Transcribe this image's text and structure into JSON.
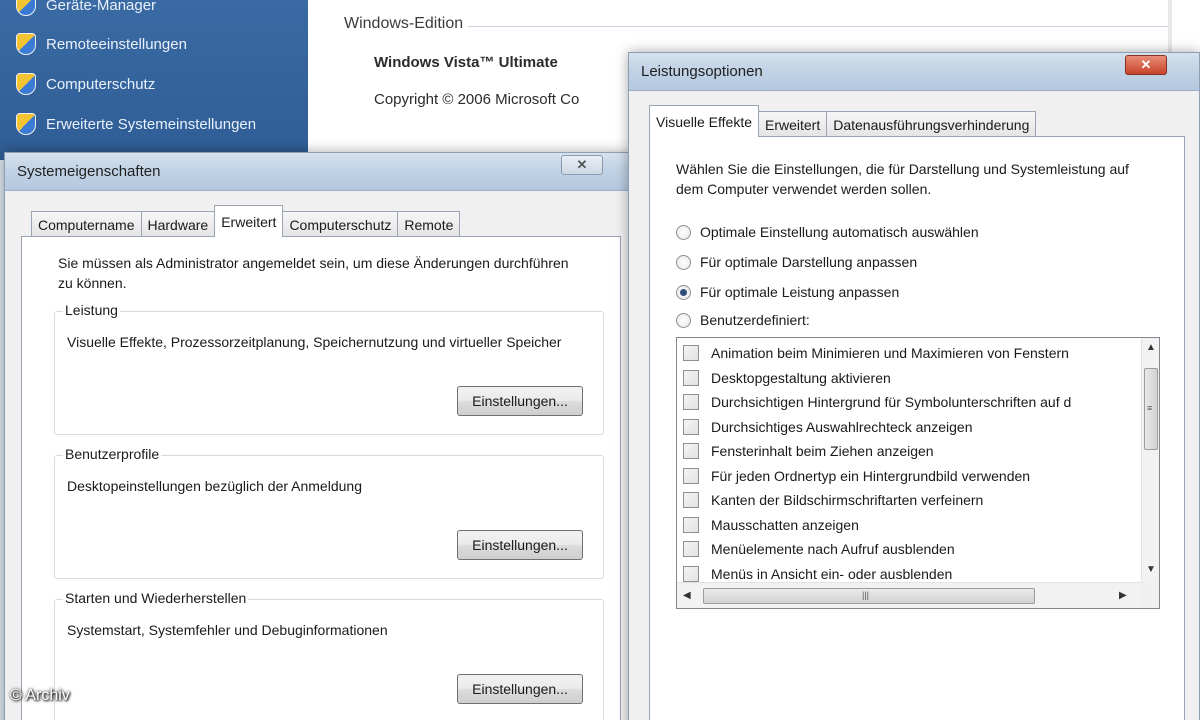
{
  "control_panel": {
    "task_items": [
      "Geräte-Manager",
      "Remoteeinstellungen",
      "Computerschutz",
      "Erweiterte Systemeinstellungen"
    ],
    "section_heading": "Windows-Edition",
    "edition": "Windows Vista™ Ultimate",
    "copyright": "Copyright © 2006 Microsoft Co"
  },
  "system_properties": {
    "title": "Systemeigenschaften",
    "close_label": "✕",
    "tabs": [
      "Computername",
      "Hardware",
      "Erweitert",
      "Computerschutz",
      "Remote"
    ],
    "active_tab": "Erweitert",
    "intro": "Sie müssen als Administrator angemeldet sein, um diese Änderungen durchführen zu können.",
    "groups": [
      {
        "label": "Leistung",
        "description": "Visuelle Effekte, Prozessorzeitplanung, Speichernutzung und virtueller Speicher",
        "button": "Einstellungen..."
      },
      {
        "label": "Benutzerprofile",
        "description": "Desktopeinstellungen bezüglich der Anmeldung",
        "button": "Einstellungen..."
      },
      {
        "label": "Starten und Wiederherstellen",
        "description": "Systemstart, Systemfehler und Debuginformationen",
        "button": "Einstellungen..."
      }
    ]
  },
  "performance_options": {
    "title": "Leistungsoptionen",
    "close_label": "✕",
    "tabs": [
      "Visuelle Effekte",
      "Erweitert",
      "Datenausführungsverhinderung"
    ],
    "active_tab": "Visuelle Effekte",
    "description": "Wählen Sie die Einstellungen, die für Darstellung und Systemleistung auf dem Computer verwendet werden sollen.",
    "radio_options": [
      {
        "label": "Optimale Einstellung automatisch auswählen",
        "checked": false
      },
      {
        "label": "Für optimale Darstellung anpassen",
        "checked": false
      },
      {
        "label": "Für optimale Leistung anpassen",
        "checked": true
      },
      {
        "label": "Benutzerdefiniert:",
        "checked": false
      }
    ],
    "effects": [
      {
        "label": "Animation beim Minimieren und Maximieren von Fenstern",
        "checked": false
      },
      {
        "label": "Desktopgestaltung aktivieren",
        "checked": false
      },
      {
        "label": "Durchsichtigen Hintergrund für Symbolunterschriften auf d",
        "checked": false
      },
      {
        "label": "Durchsichtiges Auswahlrechteck anzeigen",
        "checked": false
      },
      {
        "label": "Fensterinhalt beim Ziehen anzeigen",
        "checked": false
      },
      {
        "label": "Für jeden Ordnertyp ein Hintergrundbild verwenden",
        "checked": false
      },
      {
        "label": "Kanten der Bildschirmschriftarten verfeinern",
        "checked": false
      },
      {
        "label": "Mausschatten anzeigen",
        "checked": false
      },
      {
        "label": "Menüelemente nach Aufruf ausblenden",
        "checked": false
      },
      {
        "label": "Menüs in Ansicht ein- oder ausblenden",
        "checked": false
      }
    ]
  },
  "watermark": "© Archiv"
}
